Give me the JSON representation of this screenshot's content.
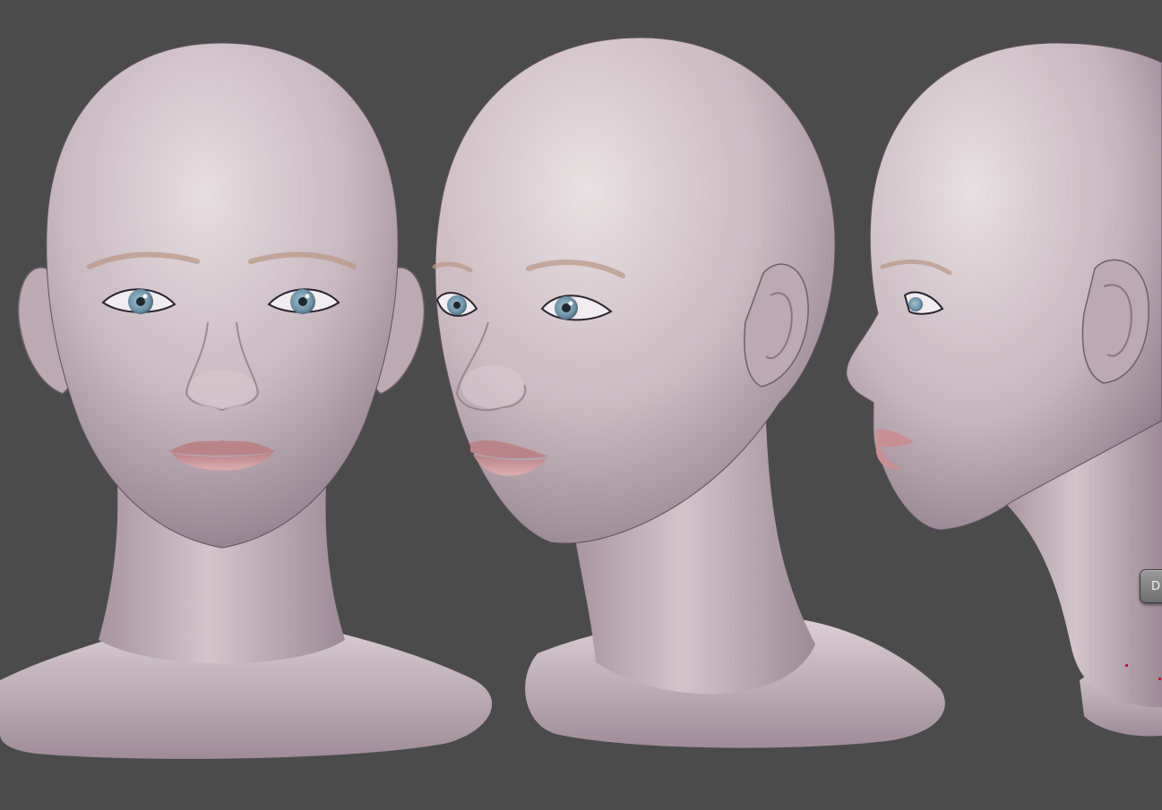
{
  "viewport": {
    "background": "#4b4b4b",
    "skin_color": "#c9b8c0",
    "iris_color": "#6d93a8",
    "lip_color": "#c89094",
    "brow_color": "#b99583",
    "views": [
      "front-view",
      "three-quarter-view",
      "side-view"
    ]
  },
  "ui": {
    "button_label": "D"
  }
}
